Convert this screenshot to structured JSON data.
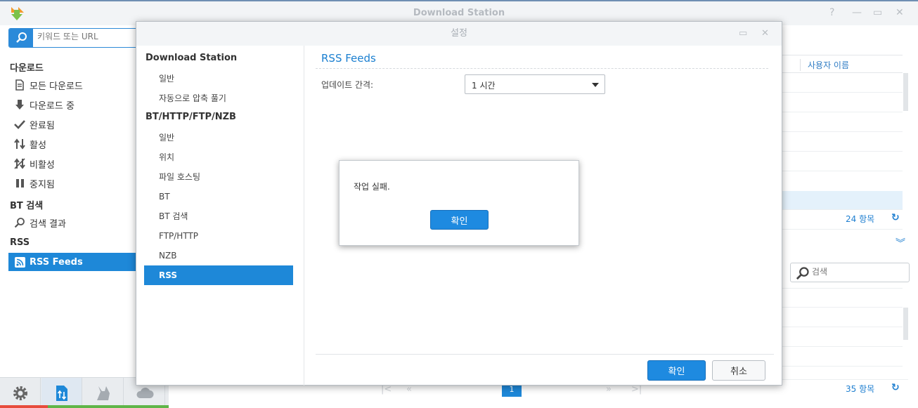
{
  "window": {
    "title": "Download Station"
  },
  "search": {
    "placeholder": "키워드 또는 URL"
  },
  "sidebar": {
    "download_header": "다운로드",
    "download_items": [
      {
        "label": "모든 다운로드",
        "icon": "document-icon"
      },
      {
        "label": "다운로드 중",
        "icon": "arrow-down-icon"
      },
      {
        "label": "완료됨",
        "icon": "checkmark-icon"
      },
      {
        "label": "활성",
        "icon": "up-down-arrows-icon"
      },
      {
        "label": "비활성",
        "icon": "inactive-icon"
      },
      {
        "label": "중지됨",
        "icon": "pause-icon"
      }
    ],
    "bt_header": "BT 검색",
    "bt_items": [
      {
        "label": "검색 결과",
        "icon": "search-icon"
      }
    ],
    "rss_header": "RSS",
    "rss_items": [
      {
        "label": "RSS Feeds",
        "icon": "rss-icon",
        "active": true
      }
    ]
  },
  "right_panel": {
    "column_header": "사용자 이름",
    "top_count": "24 항목",
    "search_placeholder": "검색",
    "bottom_count": "35 항목",
    "page": "1"
  },
  "dialog": {
    "title": "설정",
    "nav": {
      "section1": "Download Station",
      "section1_items": [
        "일반",
        "자동으로 압축 풀기"
      ],
      "section2": "BT/HTTP/FTP/NZB",
      "section2_items": [
        "일반",
        "위치",
        "파일 호스팅",
        "BT",
        "BT 검색",
        "FTP/HTTP",
        "NZB",
        "RSS"
      ],
      "active": "RSS"
    },
    "content": {
      "title": "RSS Feeds",
      "update_label": "업데이트 간격:",
      "update_value": "1 시간"
    },
    "ok_label": "확인",
    "cancel_label": "취소"
  },
  "alert": {
    "message": "작업 실패.",
    "ok_label": "확인"
  },
  "colors": {
    "accent": "#1e88d8",
    "link": "#1f7fd0"
  }
}
